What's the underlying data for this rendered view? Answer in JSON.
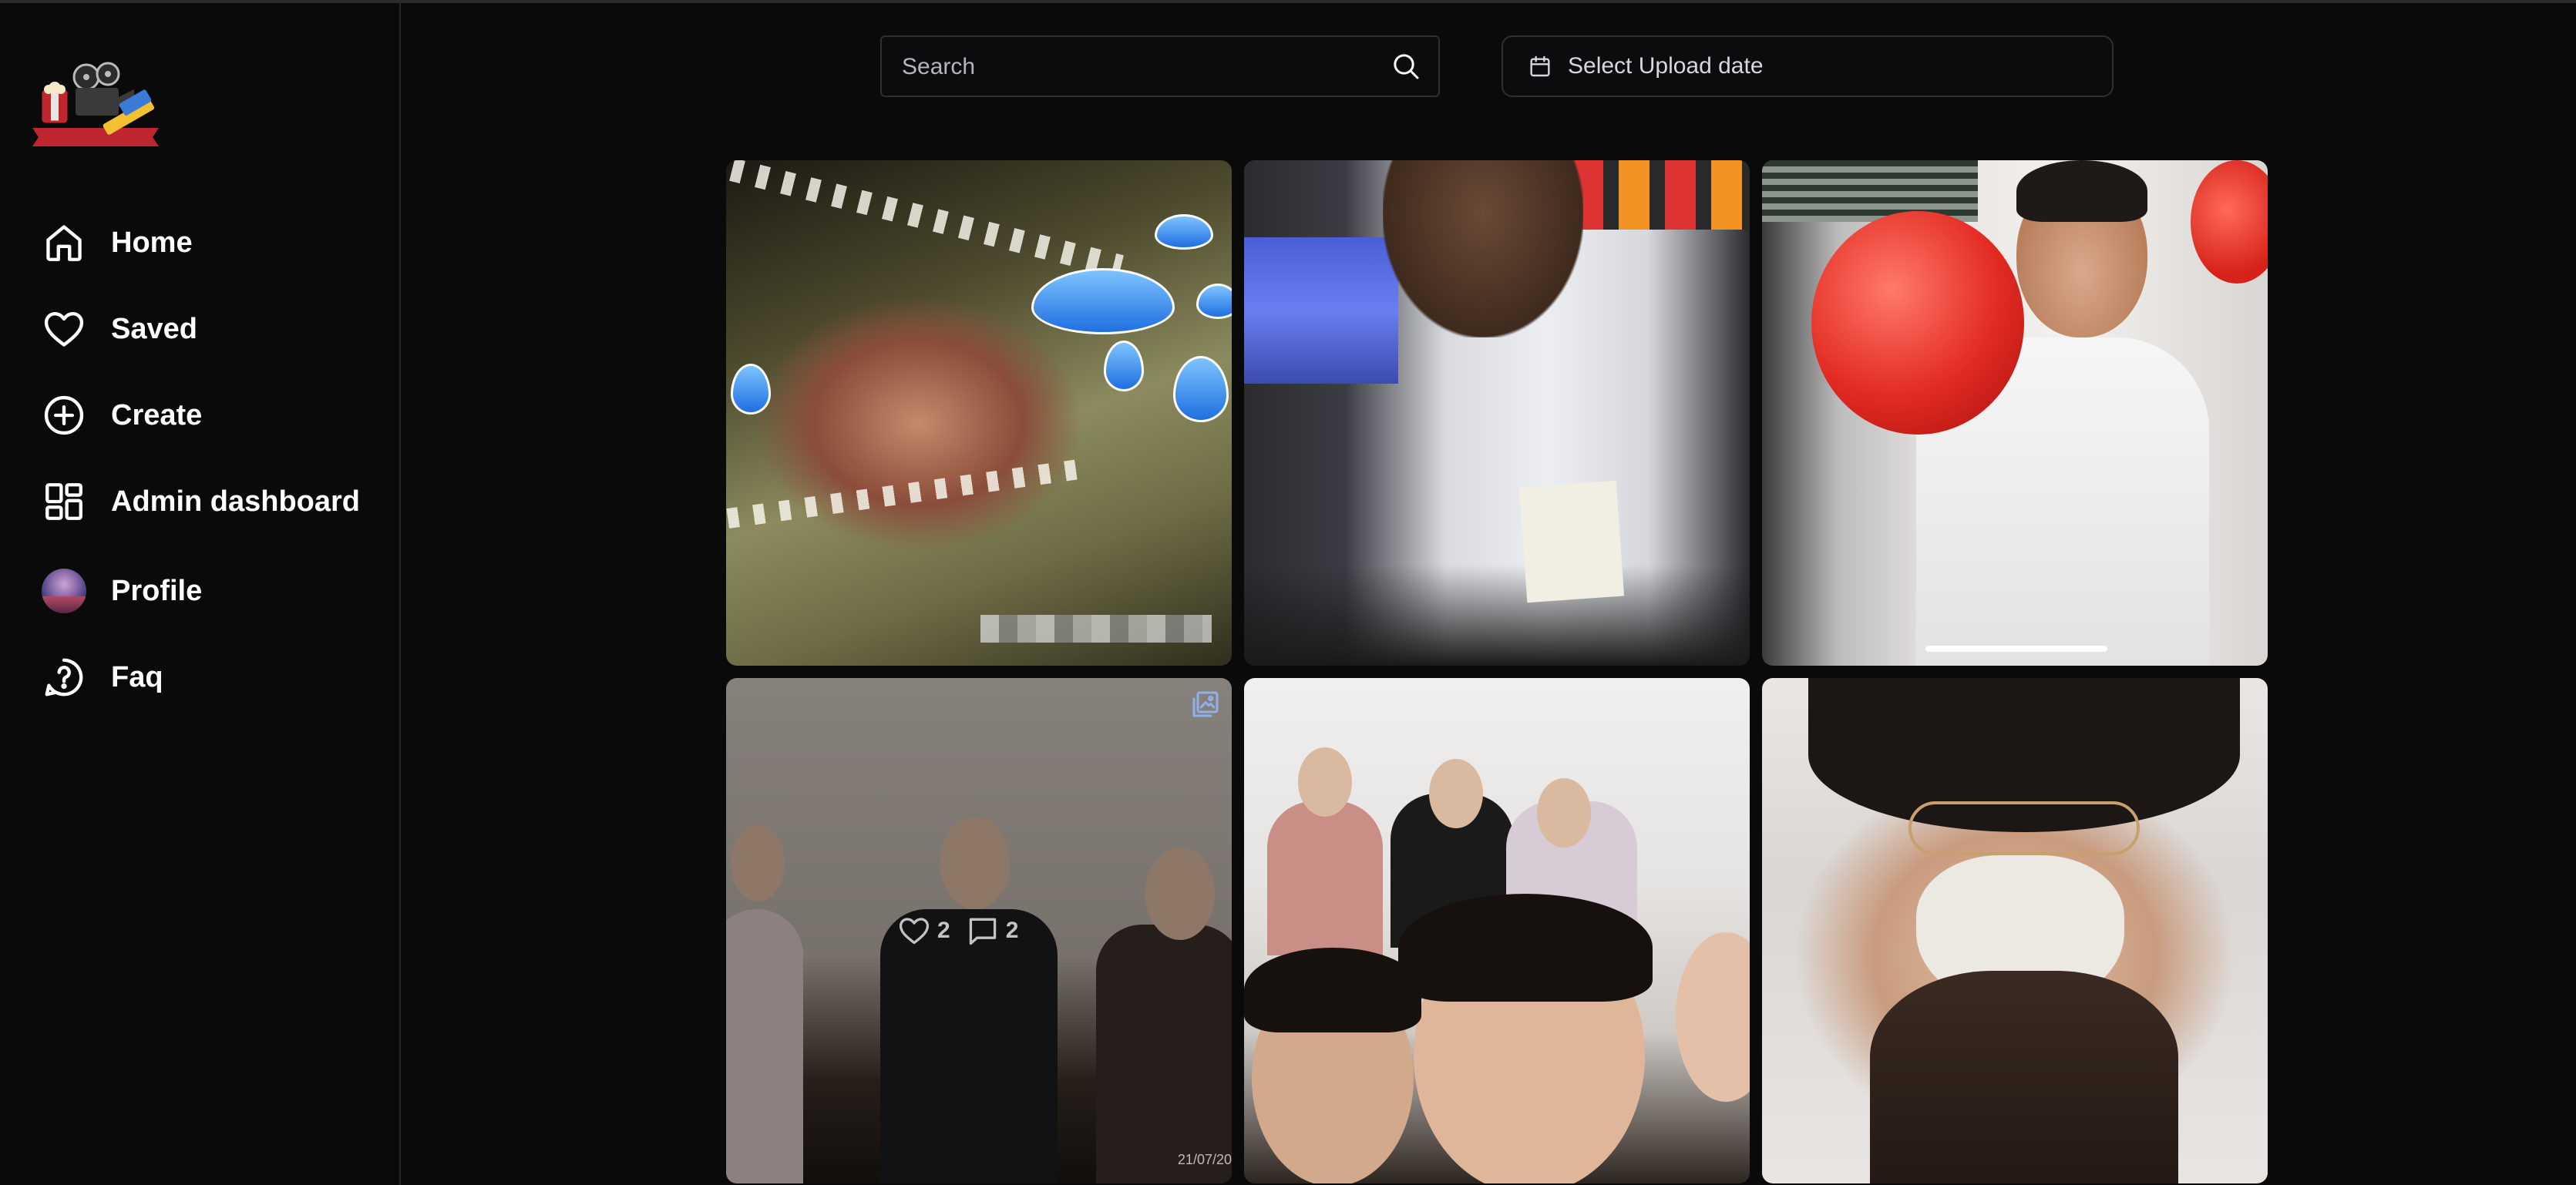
{
  "sidebar": {
    "logo_alt": "cinema logo",
    "items": [
      {
        "label": "Home",
        "icon": "home-icon"
      },
      {
        "label": "Saved",
        "icon": "heart-icon"
      },
      {
        "label": "Create",
        "icon": "plus-circle-icon"
      },
      {
        "label": "Admin dashboard",
        "icon": "dashboard-icon"
      },
      {
        "label": "Profile",
        "icon": "avatar"
      },
      {
        "label": "Faq",
        "icon": "question-icon"
      }
    ]
  },
  "toolbar": {
    "search_placeholder": "Search",
    "date_label": "Select Upload date"
  },
  "feed": {
    "tiles": [
      {
        "subject": "crocodile meme"
      },
      {
        "subject": "girl at counter with note"
      },
      {
        "subject": "man blowing red balloon",
        "video_progress_indicator": true
      },
      {
        "subject": "group photo",
        "likes": "2",
        "comments": "2",
        "timestamp": "21/07/20",
        "multi_image": true
      },
      {
        "subject": "group selfie"
      },
      {
        "subject": "selfie with mask"
      }
    ]
  },
  "colors": {
    "background": "#0a0a0b",
    "border": "#2e2e33",
    "text": "#ffffff",
    "placeholder": "#b5b5bb",
    "logo_red": "#c0262d"
  }
}
